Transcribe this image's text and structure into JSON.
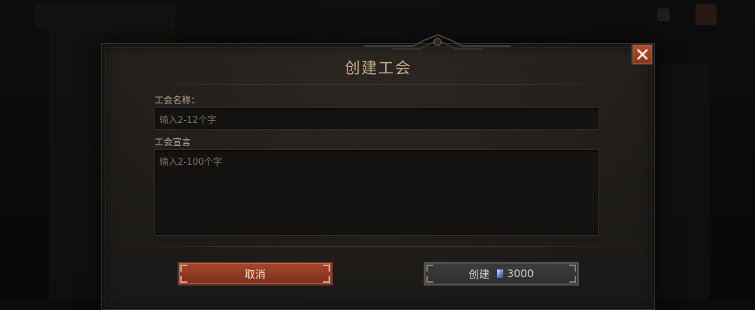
{
  "dialog": {
    "title": "创建工会",
    "name_label": "工会名称：",
    "name_placeholder": "输入2-12个字",
    "manifesto_label": "工会宣言",
    "manifesto_placeholder": "输入2-100个字"
  },
  "buttons": {
    "cancel_label": "取消",
    "create_label": "创建",
    "create_cost": "3000",
    "cost_icon": "gem-icon",
    "close_icon": "close-icon"
  },
  "colors": {
    "accent_red": "#9b4328",
    "title_gold": "#c7ad86"
  }
}
